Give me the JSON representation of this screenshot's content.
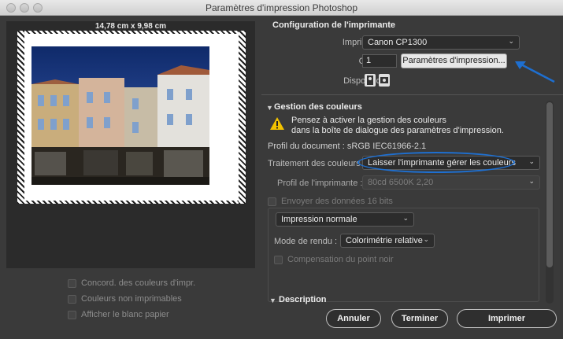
{
  "window": {
    "title": "Paramètres d'impression Photoshop"
  },
  "preview": {
    "dimensions": "14,78 cm x 9,98 cm",
    "options": [
      {
        "label": "Concord. des couleurs d'impr."
      },
      {
        "label": "Couleurs non imprimables"
      },
      {
        "label": "Afficher le blanc papier"
      }
    ]
  },
  "printer_setup": {
    "heading": "Configuration de l'imprimante",
    "printer_label": "Imprimante :",
    "printer_value": "Canon CP1300",
    "copies_label": "Copies :",
    "copies_value": "1",
    "print_settings_button": "Paramètres d'impression...",
    "layout_label": "Disposition :"
  },
  "color_management": {
    "heading": "Gestion des couleurs",
    "warning_line1": "Pensez à activer la gestion des couleurs",
    "warning_line2": "dans la boîte de dialogue des paramètres d'impression.",
    "doc_profile": "Profil du document : sRGB IEC61966-2.1",
    "handling_label": "Traitement des couleurs :",
    "handling_value": "Laisser l'imprimante gérer les couleurs",
    "printer_profile_label": "Profil de l'imprimante :",
    "printer_profile_value": "80cd 6500K 2,20",
    "send16_label": "Envoyer des données 16 bits",
    "print_mode": "Impression normale",
    "rendering_label": "Mode de rendu :",
    "rendering_value": "Colorimétrie relative",
    "bpc_label": "Compensation du point noir"
  },
  "description": {
    "heading": "Description"
  },
  "buttons": {
    "cancel": "Annuler",
    "done": "Terminer",
    "print": "Imprimer"
  },
  "colors": {
    "annotation_blue": "#1e6fd0",
    "warning_yellow": "#f2c200"
  }
}
